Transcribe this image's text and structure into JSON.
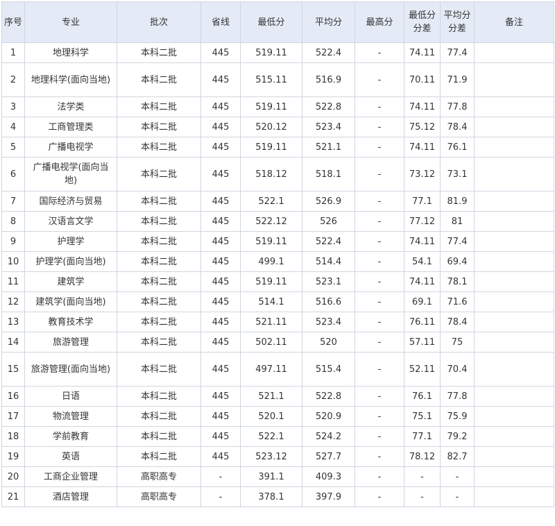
{
  "table": {
    "columns": [
      "序号",
      "专业",
      "批次",
      "省线",
      "最低分",
      "平均分",
      "最高分",
      "最低分分差",
      "平均分分差",
      "备注"
    ],
    "rows": [
      [
        "1",
        "地理科学",
        "本科二批",
        "445",
        "519.11",
        "522.4",
        "-",
        "74.11",
        "77.4",
        ""
      ],
      [
        "2",
        "地理科学(面向当地)",
        "本科二批",
        "445",
        "515.11",
        "516.9",
        "-",
        "70.11",
        "71.9",
        ""
      ],
      [
        "3",
        "法学类",
        "本科二批",
        "445",
        "519.11",
        "522.8",
        "-",
        "74.11",
        "77.8",
        ""
      ],
      [
        "4",
        "工商管理类",
        "本科二批",
        "445",
        "520.12",
        "523.4",
        "-",
        "75.12",
        "78.4",
        ""
      ],
      [
        "5",
        "广播电视学",
        "本科二批",
        "445",
        "519.11",
        "521.1",
        "-",
        "74.11",
        "76.1",
        ""
      ],
      [
        "6",
        "广播电视学(面向当地)",
        "本科二批",
        "445",
        "518.12",
        "518.1",
        "-",
        "73.12",
        "73.1",
        ""
      ],
      [
        "7",
        "国际经济与贸易",
        "本科二批",
        "445",
        "522.1",
        "526.9",
        "-",
        "77.1",
        "81.9",
        ""
      ],
      [
        "8",
        "汉语言文学",
        "本科二批",
        "445",
        "522.12",
        "526",
        "-",
        "77.12",
        "81",
        ""
      ],
      [
        "9",
        "护理学",
        "本科二批",
        "445",
        "519.11",
        "522.4",
        "-",
        "74.11",
        "77.4",
        ""
      ],
      [
        "10",
        "护理学(面向当地)",
        "本科二批",
        "445",
        "499.1",
        "514.4",
        "-",
        "54.1",
        "69.4",
        ""
      ],
      [
        "11",
        "建筑学",
        "本科二批",
        "445",
        "519.11",
        "523.1",
        "-",
        "74.11",
        "78.1",
        ""
      ],
      [
        "12",
        "建筑学(面向当地)",
        "本科二批",
        "445",
        "514.1",
        "516.6",
        "-",
        "69.1",
        "71.6",
        ""
      ],
      [
        "13",
        "教育技术学",
        "本科二批",
        "445",
        "521.11",
        "523.4",
        "-",
        "76.11",
        "78.4",
        ""
      ],
      [
        "14",
        "旅游管理",
        "本科二批",
        "445",
        "502.11",
        "520",
        "-",
        "57.11",
        "75",
        ""
      ],
      [
        "15",
        "旅游管理(面向当地)",
        "本科二批",
        "445",
        "497.11",
        "515.4",
        "-",
        "52.11",
        "70.4",
        ""
      ],
      [
        "16",
        "日语",
        "本科二批",
        "445",
        "521.1",
        "522.8",
        "-",
        "76.1",
        "77.8",
        ""
      ],
      [
        "17",
        "物流管理",
        "本科二批",
        "445",
        "520.1",
        "520.9",
        "-",
        "75.1",
        "75.9",
        ""
      ],
      [
        "18",
        "学前教育",
        "本科二批",
        "445",
        "522.1",
        "524.2",
        "-",
        "77.1",
        "79.2",
        ""
      ],
      [
        "19",
        "英语",
        "本科二批",
        "445",
        "523.12",
        "527.7",
        "-",
        "78.12",
        "82.7",
        ""
      ],
      [
        "20",
        "工商企业管理",
        "高职高专",
        "-",
        "391.1",
        "409.3",
        "-",
        "-",
        "-",
        ""
      ],
      [
        "21",
        "酒店管理",
        "高职高专",
        "-",
        "378.1",
        "397.9",
        "-",
        "-",
        "-",
        ""
      ]
    ]
  }
}
